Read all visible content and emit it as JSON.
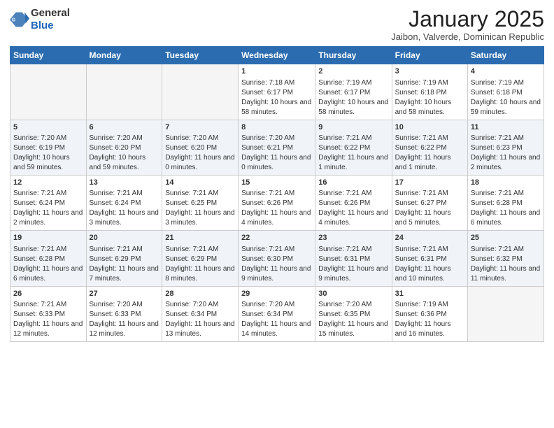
{
  "logo": {
    "general": "General",
    "blue": "Blue"
  },
  "header": {
    "month": "January 2025",
    "location": "Jaibon, Valverde, Dominican Republic"
  },
  "days_of_week": [
    "Sunday",
    "Monday",
    "Tuesday",
    "Wednesday",
    "Thursday",
    "Friday",
    "Saturday"
  ],
  "weeks": [
    [
      {
        "day": "",
        "info": ""
      },
      {
        "day": "",
        "info": ""
      },
      {
        "day": "",
        "info": ""
      },
      {
        "day": "1",
        "info": "Sunrise: 7:18 AM\nSunset: 6:17 PM\nDaylight: 10 hours and 58 minutes."
      },
      {
        "day": "2",
        "info": "Sunrise: 7:19 AM\nSunset: 6:17 PM\nDaylight: 10 hours and 58 minutes."
      },
      {
        "day": "3",
        "info": "Sunrise: 7:19 AM\nSunset: 6:18 PM\nDaylight: 10 hours and 58 minutes."
      },
      {
        "day": "4",
        "info": "Sunrise: 7:19 AM\nSunset: 6:18 PM\nDaylight: 10 hours and 59 minutes."
      }
    ],
    [
      {
        "day": "5",
        "info": "Sunrise: 7:20 AM\nSunset: 6:19 PM\nDaylight: 10 hours and 59 minutes."
      },
      {
        "day": "6",
        "info": "Sunrise: 7:20 AM\nSunset: 6:20 PM\nDaylight: 10 hours and 59 minutes."
      },
      {
        "day": "7",
        "info": "Sunrise: 7:20 AM\nSunset: 6:20 PM\nDaylight: 11 hours and 0 minutes."
      },
      {
        "day": "8",
        "info": "Sunrise: 7:20 AM\nSunset: 6:21 PM\nDaylight: 11 hours and 0 minutes."
      },
      {
        "day": "9",
        "info": "Sunrise: 7:21 AM\nSunset: 6:22 PM\nDaylight: 11 hours and 1 minute."
      },
      {
        "day": "10",
        "info": "Sunrise: 7:21 AM\nSunset: 6:22 PM\nDaylight: 11 hours and 1 minute."
      },
      {
        "day": "11",
        "info": "Sunrise: 7:21 AM\nSunset: 6:23 PM\nDaylight: 11 hours and 2 minutes."
      }
    ],
    [
      {
        "day": "12",
        "info": "Sunrise: 7:21 AM\nSunset: 6:24 PM\nDaylight: 11 hours and 2 minutes."
      },
      {
        "day": "13",
        "info": "Sunrise: 7:21 AM\nSunset: 6:24 PM\nDaylight: 11 hours and 3 minutes."
      },
      {
        "day": "14",
        "info": "Sunrise: 7:21 AM\nSunset: 6:25 PM\nDaylight: 11 hours and 3 minutes."
      },
      {
        "day": "15",
        "info": "Sunrise: 7:21 AM\nSunset: 6:26 PM\nDaylight: 11 hours and 4 minutes."
      },
      {
        "day": "16",
        "info": "Sunrise: 7:21 AM\nSunset: 6:26 PM\nDaylight: 11 hours and 4 minutes."
      },
      {
        "day": "17",
        "info": "Sunrise: 7:21 AM\nSunset: 6:27 PM\nDaylight: 11 hours and 5 minutes."
      },
      {
        "day": "18",
        "info": "Sunrise: 7:21 AM\nSunset: 6:28 PM\nDaylight: 11 hours and 6 minutes."
      }
    ],
    [
      {
        "day": "19",
        "info": "Sunrise: 7:21 AM\nSunset: 6:28 PM\nDaylight: 11 hours and 6 minutes."
      },
      {
        "day": "20",
        "info": "Sunrise: 7:21 AM\nSunset: 6:29 PM\nDaylight: 11 hours and 7 minutes."
      },
      {
        "day": "21",
        "info": "Sunrise: 7:21 AM\nSunset: 6:29 PM\nDaylight: 11 hours and 8 minutes."
      },
      {
        "day": "22",
        "info": "Sunrise: 7:21 AM\nSunset: 6:30 PM\nDaylight: 11 hours and 9 minutes."
      },
      {
        "day": "23",
        "info": "Sunrise: 7:21 AM\nSunset: 6:31 PM\nDaylight: 11 hours and 9 minutes."
      },
      {
        "day": "24",
        "info": "Sunrise: 7:21 AM\nSunset: 6:31 PM\nDaylight: 11 hours and 10 minutes."
      },
      {
        "day": "25",
        "info": "Sunrise: 7:21 AM\nSunset: 6:32 PM\nDaylight: 11 hours and 11 minutes."
      }
    ],
    [
      {
        "day": "26",
        "info": "Sunrise: 7:21 AM\nSunset: 6:33 PM\nDaylight: 11 hours and 12 minutes."
      },
      {
        "day": "27",
        "info": "Sunrise: 7:20 AM\nSunset: 6:33 PM\nDaylight: 11 hours and 12 minutes."
      },
      {
        "day": "28",
        "info": "Sunrise: 7:20 AM\nSunset: 6:34 PM\nDaylight: 11 hours and 13 minutes."
      },
      {
        "day": "29",
        "info": "Sunrise: 7:20 AM\nSunset: 6:34 PM\nDaylight: 11 hours and 14 minutes."
      },
      {
        "day": "30",
        "info": "Sunrise: 7:20 AM\nSunset: 6:35 PM\nDaylight: 11 hours and 15 minutes."
      },
      {
        "day": "31",
        "info": "Sunrise: 7:19 AM\nSunset: 6:36 PM\nDaylight: 11 hours and 16 minutes."
      },
      {
        "day": "",
        "info": ""
      }
    ]
  ]
}
